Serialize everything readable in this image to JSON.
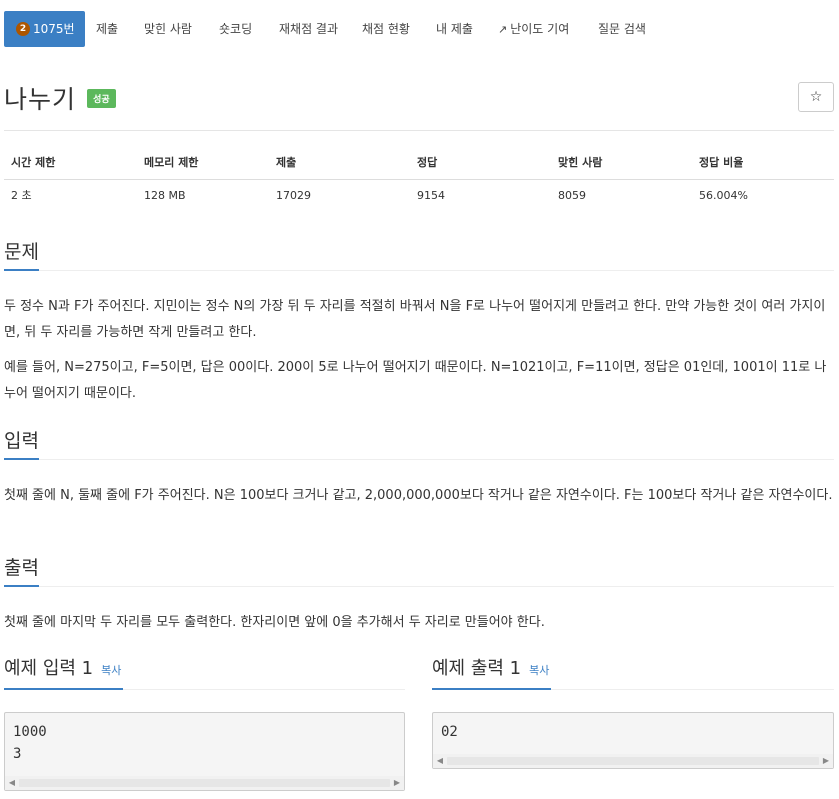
{
  "nav": {
    "tabs": [
      {
        "label": "1075번",
        "badge": "2",
        "active": true
      },
      {
        "label": "제출"
      },
      {
        "label": "맞힌 사람"
      },
      {
        "label": "숏코딩"
      },
      {
        "label": "재채점 결과"
      },
      {
        "label": "채점 현황"
      },
      {
        "label": "내 제출"
      },
      {
        "label": "난이도 기여",
        "icon": "external-link-icon"
      },
      {
        "label": "질문 검색"
      }
    ]
  },
  "problem": {
    "title": "나누기",
    "status": "성공",
    "star_glyph": "☆"
  },
  "stats": {
    "headers": [
      "시간 제한",
      "메모리 제한",
      "제출",
      "정답",
      "맞힌 사람",
      "정답 비율"
    ],
    "values": [
      "2 초",
      "128 MB",
      "17029",
      "9154",
      "8059",
      "56.004%"
    ]
  },
  "sections": {
    "description": {
      "heading": "문제",
      "paragraphs": [
        "두 정수 N과 F가 주어진다. 지민이는 정수 N의 가장 뒤 두 자리를 적절히 바꿔서 N을 F로 나누어 떨어지게 만들려고 한다. 만약 가능한 것이 여러 가지이면, 뒤 두 자리를 가능하면 작게 만들려고 한다.",
        "예를 들어, N=275이고, F=5이면, 답은 00이다. 200이 5로 나누어 떨어지기 때문이다. N=1021이고, F=11이면, 정답은 01인데, 1001이 11로 나누어 떨어지기 때문이다."
      ]
    },
    "input": {
      "heading": "입력",
      "text": "첫째 줄에 N, 둘째 줄에 F가 주어진다. N은 100보다 크거나 같고, 2,000,000,000보다 작거나 같은 자연수이다. F는 100보다 작거나 같은 자연수이다."
    },
    "output": {
      "heading": "출력",
      "text": "첫째 줄에 마지막 두 자리를 모두 출력한다. 한자리이면 앞에 0을 추가해서 두 자리로 만들어야 한다."
    }
  },
  "examples": {
    "input": {
      "heading": "예제 입력 1",
      "copy_label": "복사",
      "code": "1000\n3"
    },
    "output": {
      "heading": "예제 출력 1",
      "copy_label": "복사",
      "code": "02"
    }
  },
  "colors": {
    "accent": "#3b7fc4",
    "success": "#5cb85c",
    "tier_bronze": "#ad5600"
  }
}
